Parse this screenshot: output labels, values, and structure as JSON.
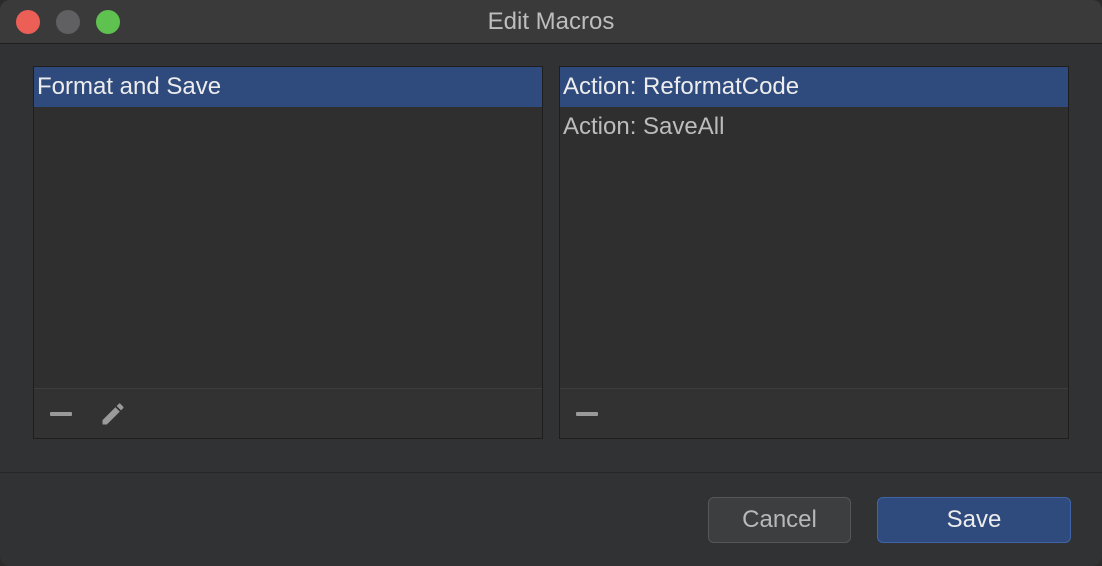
{
  "window": {
    "title": "Edit Macros"
  },
  "macros_list": {
    "items": [
      {
        "label": "Format and Save",
        "selected": true
      }
    ]
  },
  "actions_list": {
    "items": [
      {
        "label": "Action: ReformatCode",
        "selected": true
      },
      {
        "label": "Action: SaveAll",
        "selected": false
      }
    ]
  },
  "left_toolbar": {
    "icons": [
      "minus-icon",
      "pencil-icon"
    ]
  },
  "right_toolbar": {
    "icons": [
      "minus-icon"
    ]
  },
  "footer": {
    "cancel_label": "Cancel",
    "save_label": "Save"
  },
  "colors": {
    "selection": "#2f4b7e",
    "close": "#ec5f57",
    "minimize": "#606062",
    "maximize": "#5fc14f"
  }
}
